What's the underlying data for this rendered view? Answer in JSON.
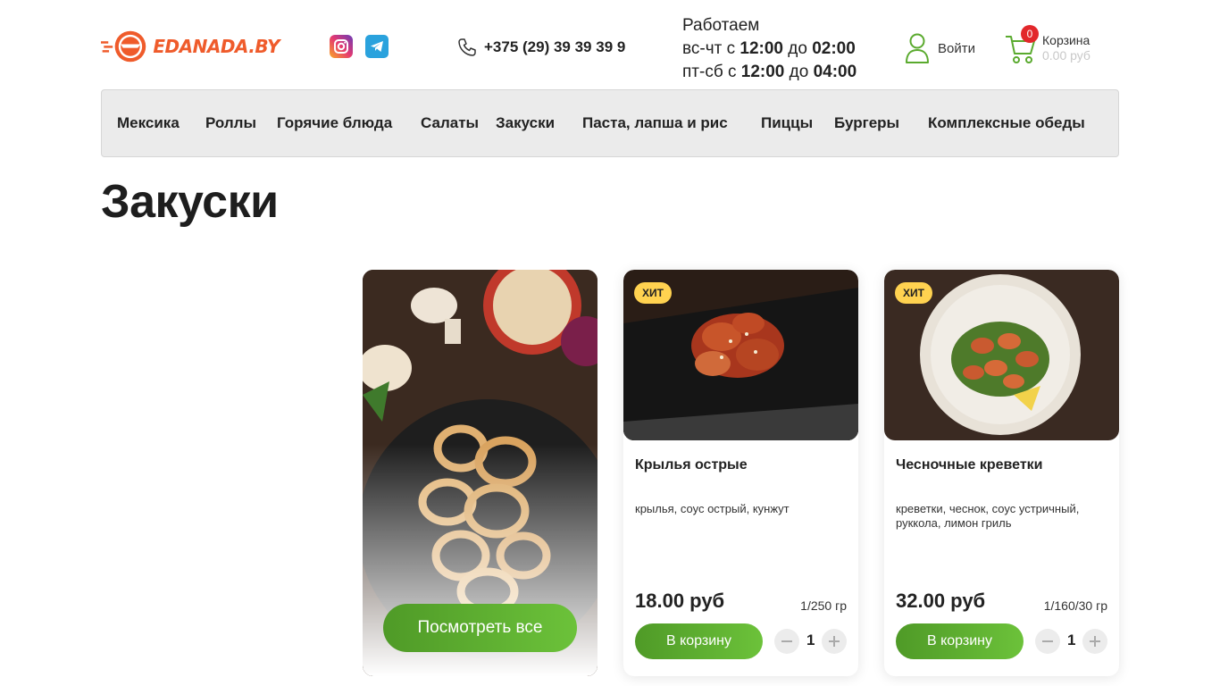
{
  "header": {
    "logo_text": "EDANADA.BY",
    "phone": "+375 (29) 39 39 39 9",
    "hours": {
      "title": "Работаем",
      "line1_days": "вс-чт с",
      "line1_from": "12:00",
      "line1_to_word": "до",
      "line1_to": "02:00",
      "line2_days": "пт-сб с",
      "line2_from": "12:00",
      "line2_to_word": "до",
      "line2_to": "04:00"
    },
    "login_label": "Войти",
    "cart": {
      "label": "Корзина",
      "sum": "0.00 руб",
      "count": "0"
    }
  },
  "nav": {
    "items": [
      {
        "label": "Мексика"
      },
      {
        "label": "Роллы"
      },
      {
        "label": "Горячие блюда"
      },
      {
        "label": "Салаты"
      },
      {
        "label": "Закуски"
      },
      {
        "label": "Паста, лапша и рис"
      },
      {
        "label": "Пиццы"
      },
      {
        "label": "Бургеры"
      },
      {
        "label": "Комплексные обеды"
      }
    ]
  },
  "page": {
    "title": "Закуски"
  },
  "promo": {
    "button_label": "Посмотреть все"
  },
  "products": [
    {
      "badge": "ХИТ",
      "title": "Крылья острые",
      "description": "крылья, соус острый, кунжут",
      "price": "18.00 руб",
      "weight": "1/250 гр",
      "button_label": "В корзину",
      "quantity": "1"
    },
    {
      "badge": "ХИТ",
      "title": "Чесночные креветки",
      "description": "креветки, чеснок, соус устричный, руккола, лимон гриль",
      "price": "32.00 руб",
      "weight": "1/160/30 гр",
      "button_label": "В корзину",
      "quantity": "1"
    }
  ],
  "colors": {
    "brand_orange": "#ef5b2b",
    "accent_green": "#5aaa2e",
    "badge_yellow": "#ffd250",
    "cart_badge_red": "#e2272b"
  },
  "icons": {
    "logo": "plane-globe-icon",
    "instagram": "instagram-icon",
    "telegram": "telegram-icon",
    "phone": "phone-icon",
    "user": "user-icon",
    "cart": "cart-icon"
  }
}
